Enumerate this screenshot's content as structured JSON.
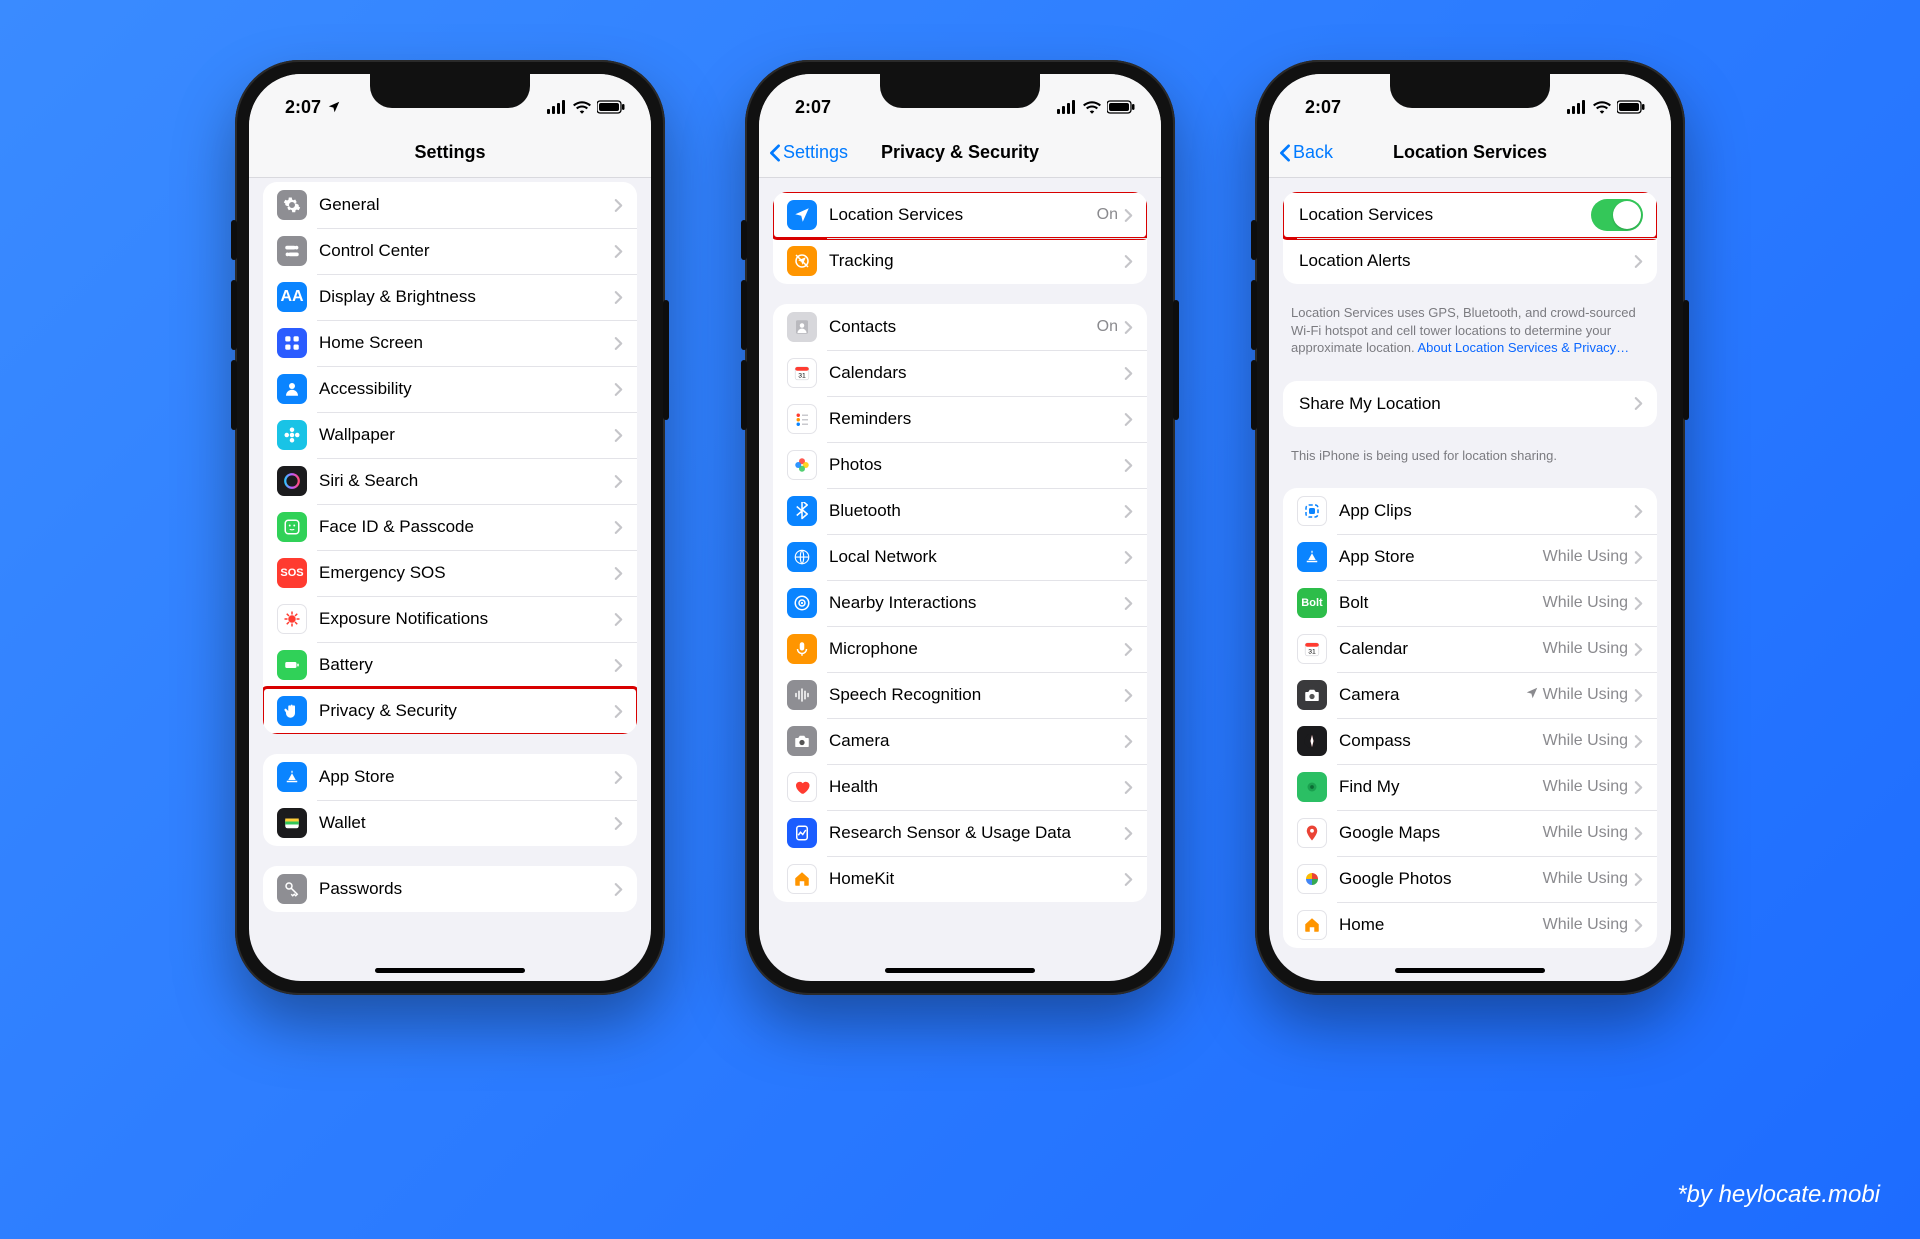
{
  "credit": "*by heylocate.mobi",
  "status": {
    "time": "2:07"
  },
  "phone1": {
    "title": "Settings",
    "g1": [
      {
        "icon": "gear",
        "bg": "#8e8e93",
        "label": "General"
      },
      {
        "icon": "toggles",
        "bg": "#8e8e93",
        "label": "Control Center"
      },
      {
        "icon": "aa",
        "bg": "#0a84ff",
        "label": "Display & Brightness"
      },
      {
        "icon": "grid",
        "bg": "#2b5cff",
        "label": "Home Screen"
      },
      {
        "icon": "person",
        "bg": "#0a84ff",
        "label": "Accessibility"
      },
      {
        "icon": "flower",
        "bg": "#19c3e6",
        "label": "Wallpaper"
      },
      {
        "icon": "siri",
        "bg": "#1b1b1d",
        "label": "Siri & Search"
      },
      {
        "icon": "faceid",
        "bg": "#30d158",
        "label": "Face ID & Passcode"
      },
      {
        "icon": "sos",
        "bg": "#ff3b30",
        "label": "Emergency SOS"
      },
      {
        "icon": "virus",
        "bg": "#ffffff",
        "fg": "#ff3b30",
        "label": "Exposure Notifications"
      },
      {
        "icon": "battery",
        "bg": "#30d158",
        "label": "Battery"
      },
      {
        "icon": "hand",
        "bg": "#0a84ff",
        "label": "Privacy & Security",
        "highlight": true
      }
    ],
    "g2": [
      {
        "icon": "appstore",
        "bg": "#0a84ff",
        "label": "App Store"
      },
      {
        "icon": "wallet",
        "bg": "#1b1b1d",
        "label": "Wallet"
      }
    ],
    "g3": [
      {
        "icon": "key",
        "bg": "#8e8e93",
        "label": "Passwords"
      }
    ]
  },
  "phone2": {
    "back": "Settings",
    "title": "Privacy & Security",
    "g1": [
      {
        "icon": "location",
        "bg": "#0a84ff",
        "label": "Location Services",
        "detail": "On",
        "highlight": true
      },
      {
        "icon": "tracking",
        "bg": "#ff9500",
        "label": "Tracking"
      }
    ],
    "g2": [
      {
        "icon": "contacts",
        "bg": "#d7d7db",
        "label": "Contacts",
        "detail": "On"
      },
      {
        "icon": "calendar",
        "bg": "#ffffff",
        "fg": "#ff3b30",
        "label": "Calendars"
      },
      {
        "icon": "reminders",
        "bg": "#ffffff",
        "label": "Reminders"
      },
      {
        "icon": "photos",
        "bg": "#ffffff",
        "label": "Photos"
      },
      {
        "icon": "bluetooth",
        "bg": "#0a84ff",
        "label": "Bluetooth"
      },
      {
        "icon": "network",
        "bg": "#0a84ff",
        "label": "Local Network"
      },
      {
        "icon": "nearby",
        "bg": "#0a84ff",
        "label": "Nearby Interactions"
      },
      {
        "icon": "mic",
        "bg": "#ff9500",
        "label": "Microphone"
      },
      {
        "icon": "speech",
        "bg": "#8e8e93",
        "label": "Speech Recognition"
      },
      {
        "icon": "camera",
        "bg": "#8e8e93",
        "label": "Camera"
      },
      {
        "icon": "health",
        "bg": "#ffffff",
        "fg": "#ff3b30",
        "label": "Health"
      },
      {
        "icon": "research",
        "bg": "#1b5dff",
        "label": "Research Sensor & Usage Data"
      },
      {
        "icon": "homekit",
        "bg": "#ffffff",
        "fg": "#ff9500",
        "label": "HomeKit"
      }
    ]
  },
  "phone3": {
    "back": "Back",
    "title": "Location Services",
    "g1": [
      {
        "label": "Location Services",
        "toggle": true,
        "highlight": true
      },
      {
        "label": "Location Alerts",
        "chevron": true
      }
    ],
    "foot1_a": "Location Services uses GPS, Bluetooth, and crowd-sourced Wi-Fi hotspot and cell tower locations to determine your approximate location. ",
    "foot1_link": "About Location Services & Privacy…",
    "g2": [
      {
        "label": "Share My Location",
        "chevron": true
      }
    ],
    "foot2": "This iPhone is being used for location sharing.",
    "g3": [
      {
        "icon": "appclips",
        "bg": "#ffffff",
        "stroke": "#0a84ff",
        "label": "App Clips"
      },
      {
        "icon": "appstore",
        "bg": "#0a84ff",
        "label": "App Store",
        "detail": "While Using"
      },
      {
        "icon": "bolt",
        "bg": "#2dbd4a",
        "label": "Bolt",
        "detail": "While Using"
      },
      {
        "icon": "calendar",
        "bg": "#ffffff",
        "label": "Calendar",
        "detail": "While Using"
      },
      {
        "icon": "camera",
        "bg": "#3a3a3c",
        "label": "Camera",
        "detail": "While Using",
        "recent": true
      },
      {
        "icon": "compass",
        "bg": "#1b1b1d",
        "label": "Compass",
        "detail": "While Using"
      },
      {
        "icon": "findmy",
        "bg": "#2bbf64",
        "label": "Find My",
        "detail": "While Using"
      },
      {
        "icon": "gmaps",
        "bg": "#ffffff",
        "label": "Google Maps",
        "detail": "While Using"
      },
      {
        "icon": "gphotos",
        "bg": "#ffffff",
        "label": "Google Photos",
        "detail": "While Using"
      },
      {
        "icon": "home",
        "bg": "#ffffff",
        "fg": "#ff9500",
        "label": "Home",
        "detail": "While Using"
      }
    ]
  }
}
